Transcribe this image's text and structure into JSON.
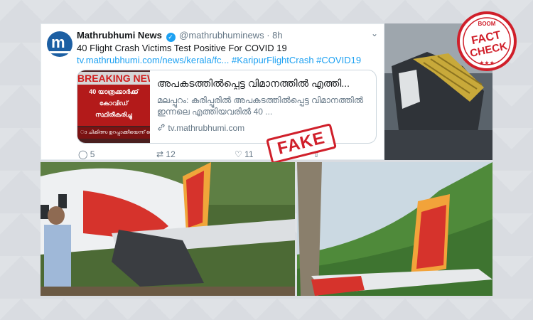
{
  "tweet": {
    "name": "Mathrubhumi News",
    "handle": "@mathrubhuminews",
    "time": "8h",
    "text": "40 Flight Crash Victims Test Positive For COVID 19",
    "link": "tv.mathrubhumi.com/news/kerala/fc...",
    "hashtags": "#KaripurFlightCrash #COVID19",
    "card": {
      "thumb_banner": "BREAKING NEWS",
      "thumb_line1": "40 യാത്രക്കാർക്ക്",
      "thumb_line2": "കോവിഡ്",
      "thumb_line3": "സ്ഥിരീകരിച്ചു",
      "thumb_bottom": "ാ ചികിത്സ ഉറപ്പാക്കിയെന്ന് കൊ",
      "title": "അപകടത്തിൽപ്പെട്ട വിമാനത്തിൽ എത്തി...",
      "description": "മലപ്പുറം: കരിപ്പൂരിൽ അപകടത്തിൽപ്പെട്ട വിമാനത്തിൽ ഇന്നലെ എത്തിയവരിൽ 40 ...",
      "domain": "tv.mathrubhumi.com"
    },
    "actions": {
      "replies": "5",
      "retweets": "12",
      "likes": "11"
    }
  },
  "stamp": "FAKE",
  "badge": {
    "top": "BOOM",
    "line1": "FACT",
    "line2": "CHECK"
  },
  "colors": {
    "stamp_red": "#d01f2a",
    "twitter_blue": "#1da1f2",
    "background": "#d9dce1"
  }
}
